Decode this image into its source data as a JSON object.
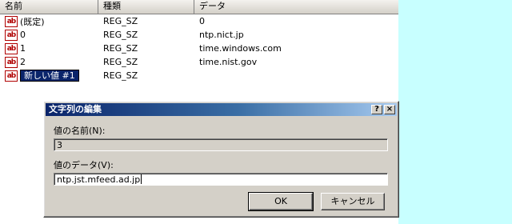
{
  "registry": {
    "columns": {
      "name": "名前",
      "type": "種類",
      "data": "データ"
    },
    "rows": [
      {
        "name": "(既定)",
        "type": "REG_SZ",
        "data": "0",
        "icon": "string-value-icon"
      },
      {
        "name": "0",
        "type": "REG_SZ",
        "data": "ntp.nict.jp",
        "icon": "string-value-icon"
      },
      {
        "name": "1",
        "type": "REG_SZ",
        "data": "time.windows.com",
        "icon": "string-value-icon"
      },
      {
        "name": "2",
        "type": "REG_SZ",
        "data": "time.nist.gov",
        "icon": "string-value-icon"
      },
      {
        "name": "新しい値 #1",
        "type": "REG_SZ",
        "data": "",
        "icon": "string-value-icon",
        "editing": true
      }
    ],
    "icon_text": "ab"
  },
  "dialog": {
    "title": "文字列の編集",
    "help_button": "?",
    "close_button": "×",
    "value_name_label": "値の名前(N):",
    "value_name": "3",
    "value_data_label": "値のデータ(V):",
    "value_data": "ntp.jst.mfeed.ad.jp",
    "ok_label": "OK",
    "cancel_label": "キャンセル"
  },
  "colors": {
    "background": "#c8ffff",
    "titlebar_start": "#0a246a",
    "titlebar_end": "#a6caf0",
    "dialog_face": "#d4d0c8",
    "selection": "#0a246a"
  }
}
